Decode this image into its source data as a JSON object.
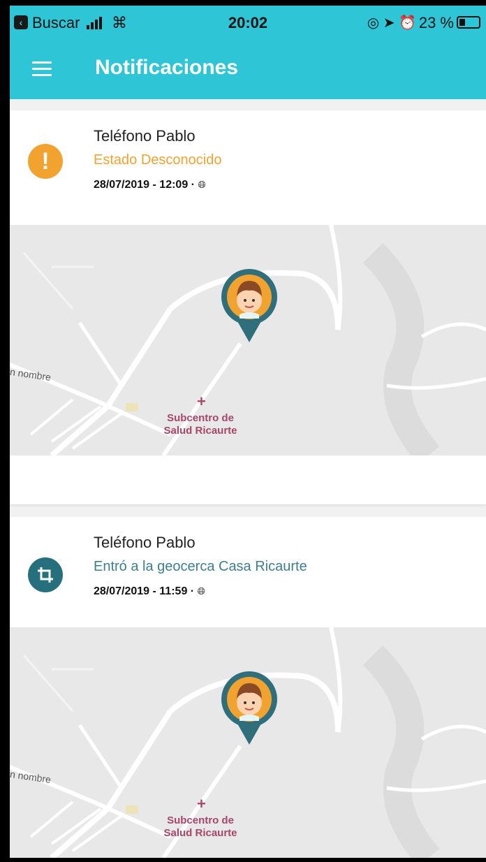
{
  "status_bar": {
    "carrier": "Buscar",
    "time": "20:02",
    "battery": "23 %"
  },
  "app_bar": {
    "title": "Notificaciones"
  },
  "notifications": [
    {
      "device": "Teléfono Pablo",
      "status": "Estado Desconocido",
      "status_color": "#f2a22f",
      "icon": "warning-icon",
      "datetime": "28/07/2019 - 12:09 · ",
      "map": {
        "street_label": "n nombre",
        "place_line1": "Subcentro de",
        "place_line2": "Salud Ricaurte"
      }
    },
    {
      "device": "Teléfono Pablo",
      "status": "Entró a la geocerca Casa Ricaurte",
      "status_color": "#3d7f8e",
      "icon": "geofence-crop-icon",
      "datetime": "28/07/2019 - 11:59 · ",
      "map": {
        "street_label": "n nombre",
        "place_line1": "Subcentro de",
        "place_line2": "Salud Ricaurte"
      }
    }
  ],
  "colors": {
    "accent": "#2ec6d6",
    "warning": "#f2a22f",
    "geofence": "#26707e",
    "pin": "#2f6f7c",
    "place": "#a8466a"
  }
}
